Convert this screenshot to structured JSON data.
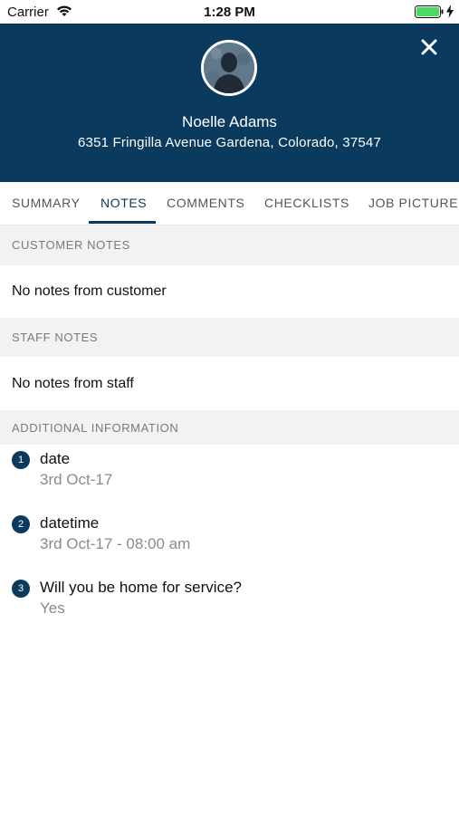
{
  "status_bar": {
    "carrier": "Carrier",
    "time": "1:28 PM",
    "icons": [
      "wifi-icon",
      "battery-icon",
      "charging-bolt-icon"
    ]
  },
  "header": {
    "background_color": "#0a3a5e",
    "name": "Noelle Adams",
    "address": "6351 Fringilla Avenue Gardena, Colorado, 37547",
    "icons": [
      "close-icon",
      "avatar-placeholder-icon"
    ]
  },
  "tabs": [
    {
      "label": "SUMMARY",
      "active": false
    },
    {
      "label": "NOTES",
      "active": true
    },
    {
      "label": "COMMENTS",
      "active": false
    },
    {
      "label": "CHECKLISTS",
      "active": false
    },
    {
      "label": "JOB PICTURES",
      "active": false
    }
  ],
  "customer_notes": {
    "header": "CUSTOMER NOTES",
    "text": "No notes from customer"
  },
  "staff_notes": {
    "header": "STAFF NOTES",
    "text": "No notes from staff"
  },
  "additional_information": {
    "header": "ADDITIONAL INFORMATION",
    "items": [
      {
        "number": "1",
        "question": "date",
        "answer": "3rd Oct-17"
      },
      {
        "number": "2",
        "question": "datetime",
        "answer": "3rd Oct-17 - 08:00 am"
      },
      {
        "number": "3",
        "question": "Will you be home for service?",
        "answer": "Yes"
      }
    ]
  },
  "colors": {
    "primary": "#0a3a5e",
    "section_background": "#f2f2f2",
    "muted_text": "#8a8a8a"
  }
}
